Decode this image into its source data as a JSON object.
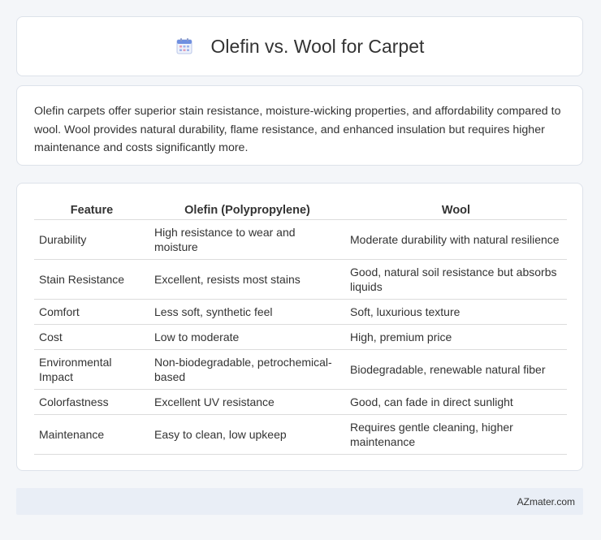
{
  "header": {
    "title": "Olefin vs. Wool for Carpet",
    "icon": "calendar-icon"
  },
  "summary": {
    "text": "Olefin carpets offer superior stain resistance, moisture-wicking properties, and affordability compared to wool. Wool provides natural durability, flame resistance, and enhanced insulation but requires higher maintenance and costs significantly more."
  },
  "table": {
    "headers": [
      "Feature",
      "Olefin (Polypropylene)",
      "Wool"
    ],
    "rows": [
      [
        "Durability",
        "High resistance to wear and moisture",
        "Moderate durability with natural resilience"
      ],
      [
        "Stain Resistance",
        "Excellent, resists most stains",
        "Good, natural soil resistance but absorbs liquids"
      ],
      [
        "Comfort",
        "Less soft, synthetic feel",
        "Soft, luxurious texture"
      ],
      [
        "Cost",
        "Low to moderate",
        "High, premium price"
      ],
      [
        "Environmental Impact",
        "Non-biodegradable, petrochemical-based",
        "Biodegradable, renewable natural fiber"
      ],
      [
        "Colorfastness",
        "Excellent UV resistance",
        "Good, can fade in direct sunlight"
      ],
      [
        "Maintenance",
        "Easy to clean, low upkeep",
        "Requires gentle cleaning, higher maintenance"
      ]
    ]
  },
  "footer": {
    "brand": "AZmater.com"
  },
  "colors": {
    "background": "#f4f6f9",
    "card": "#ffffff",
    "footer": "#e9eef6",
    "icon_accent": "#5b7fd6"
  }
}
